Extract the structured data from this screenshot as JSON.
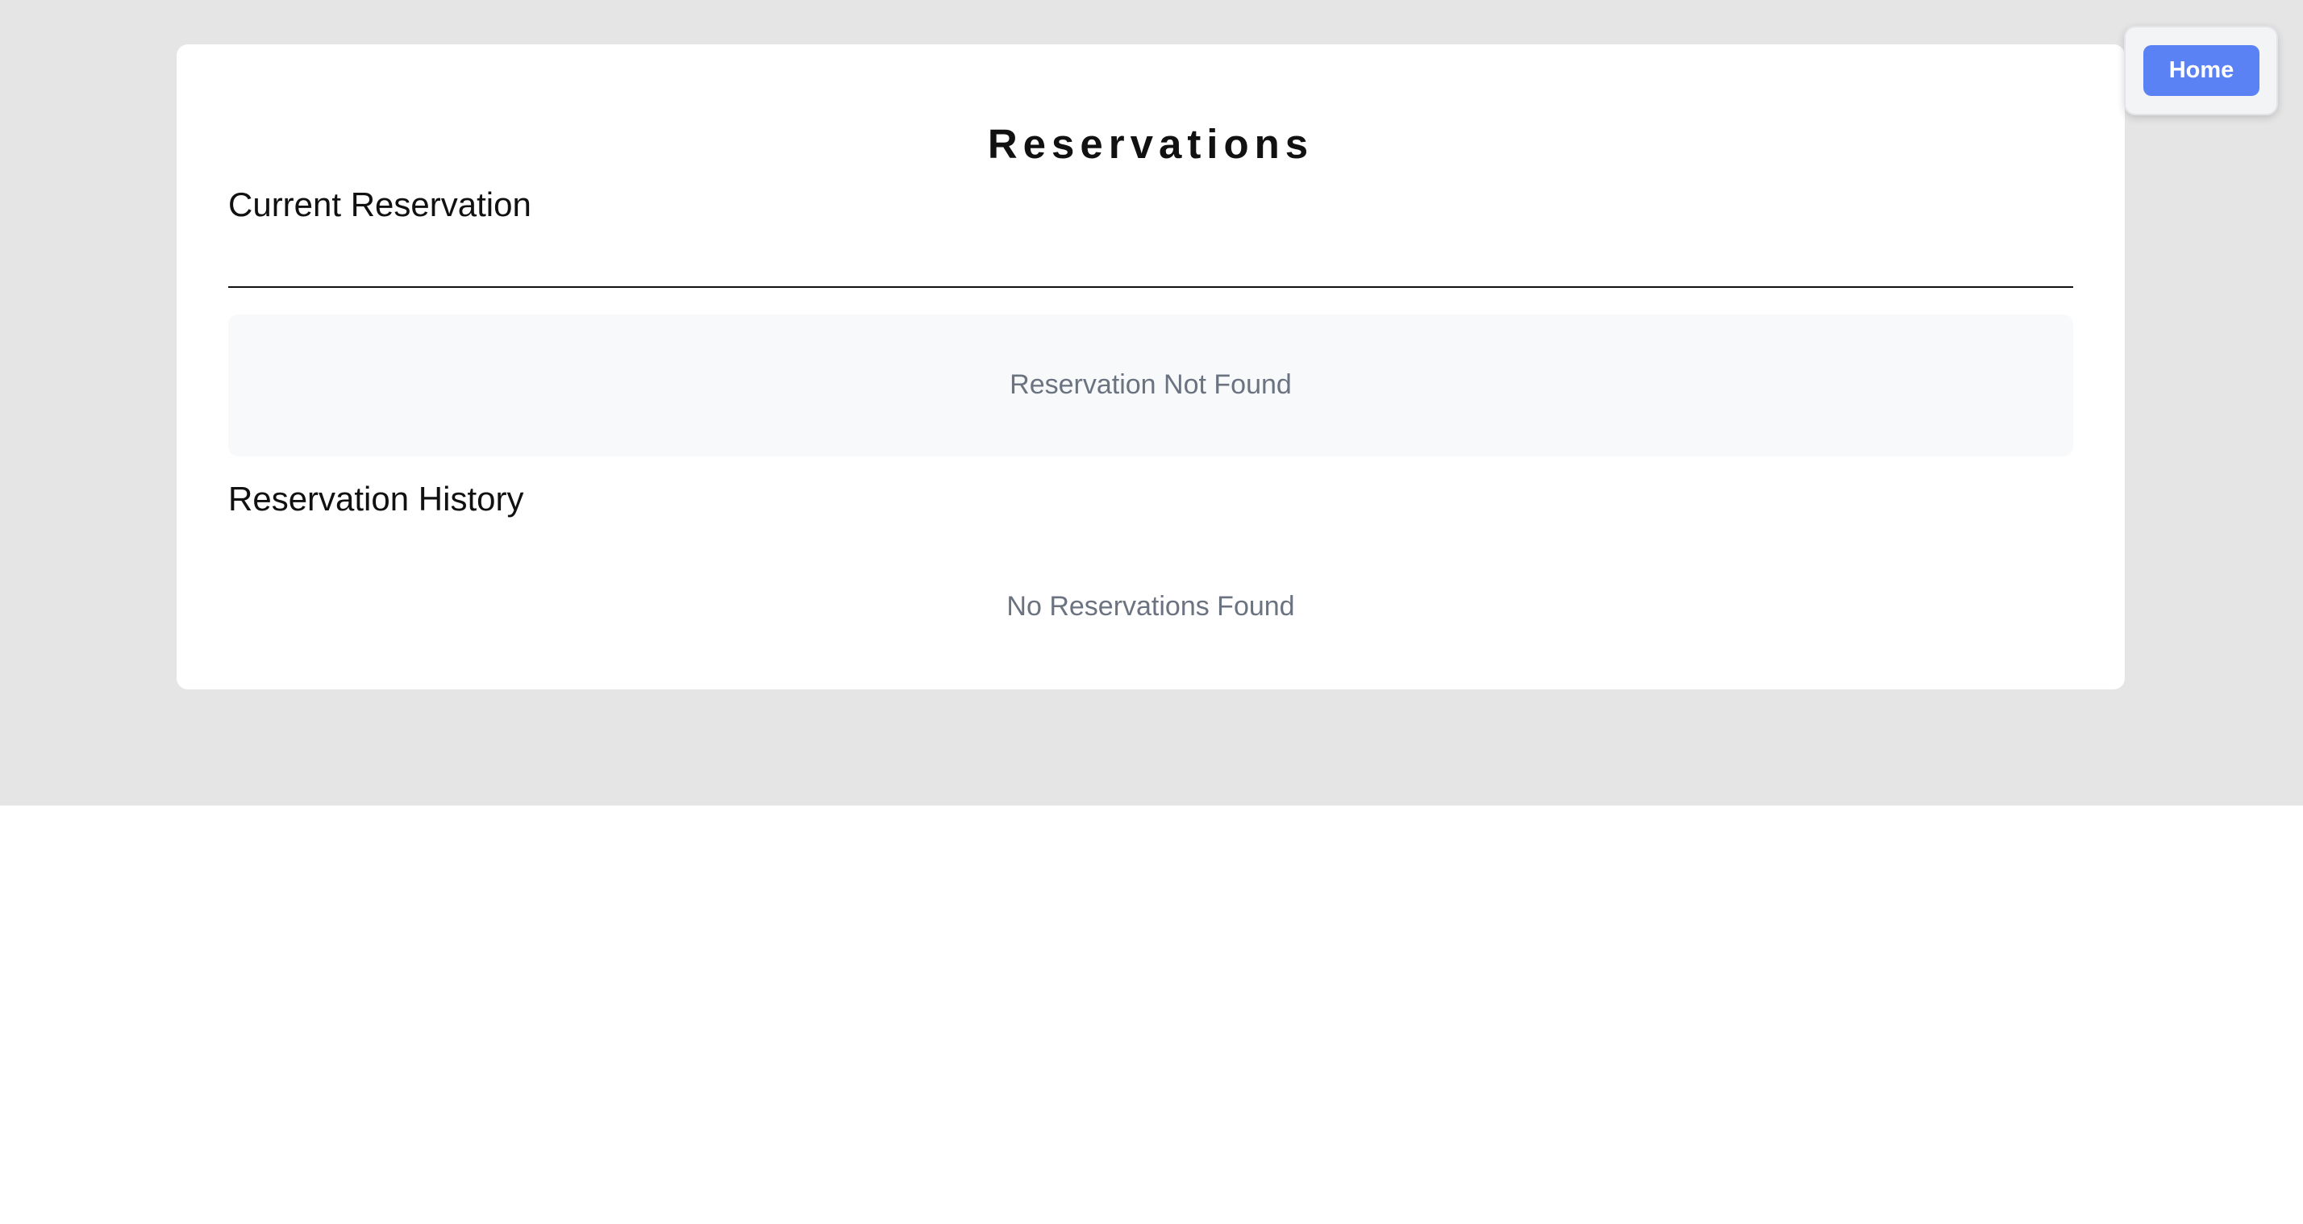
{
  "page": {
    "title": "Reservations"
  },
  "current_reservation": {
    "title": "Current Reservation",
    "empty_message": "Reservation Not Found"
  },
  "reservation_history": {
    "title": "Reservation History",
    "empty_message": "No Reservations Found"
  },
  "nav": {
    "home_label": "Home"
  },
  "colors": {
    "backdrop": "#e5e5e5",
    "card": "#ffffff",
    "accent": "#5b82f5",
    "muted_text": "#6b7280",
    "empty_box": "#f8f9fa"
  }
}
